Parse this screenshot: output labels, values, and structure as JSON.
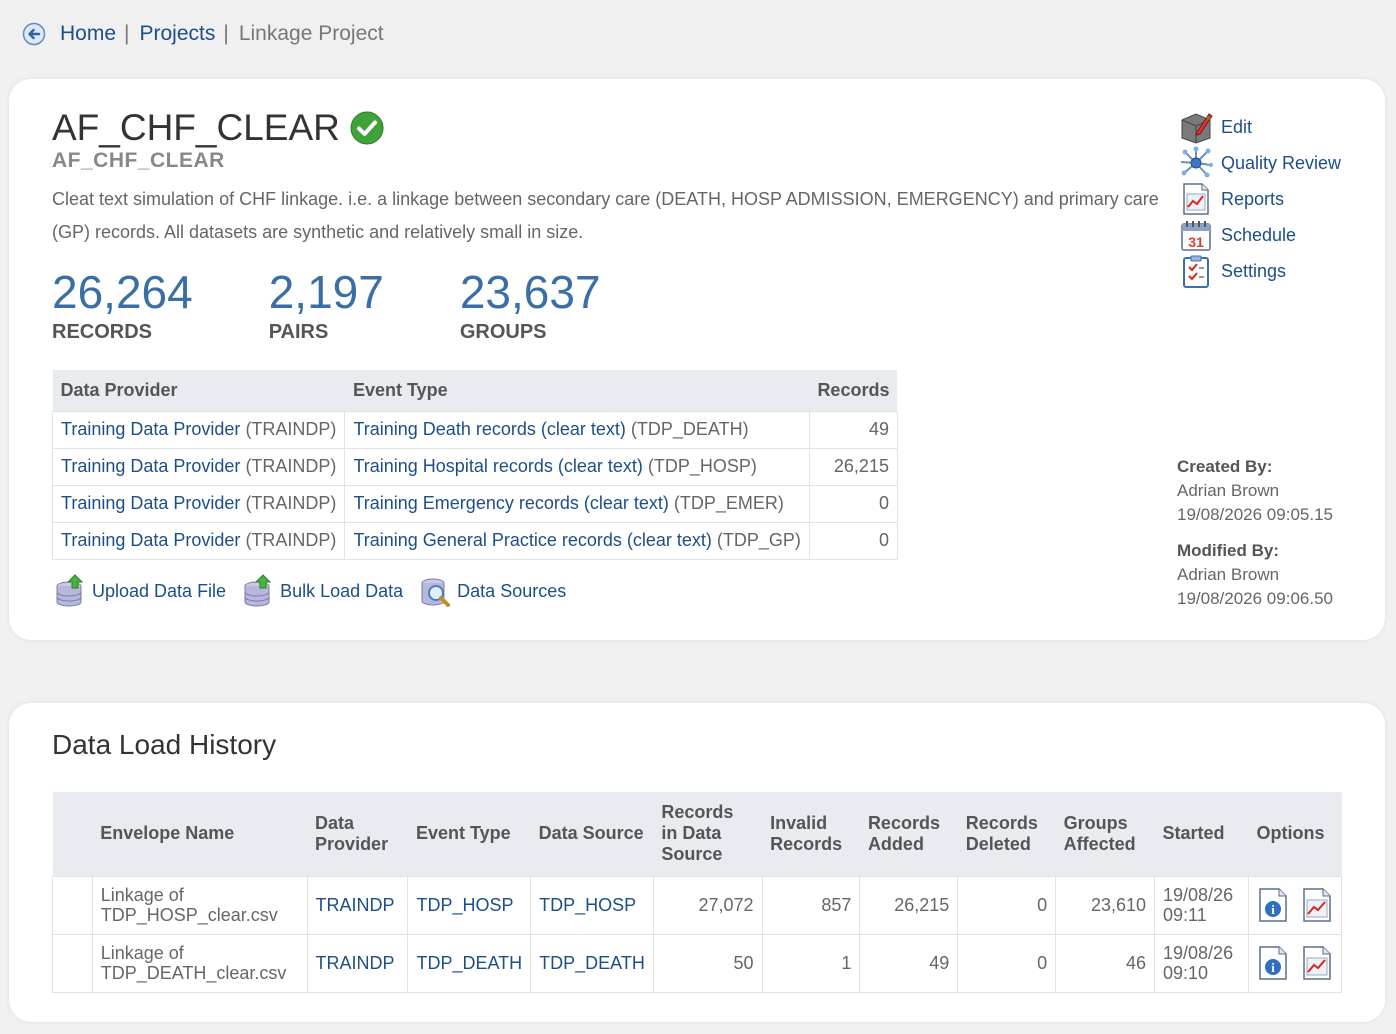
{
  "breadcrumb": {
    "home": "Home",
    "projects": "Projects",
    "current": "Linkage Project",
    "separator": "|"
  },
  "project": {
    "title": "AF_CHF_CLEAR",
    "code": "AF_CHF_CLEAR",
    "description": "Cleat text simulation of CHF linkage. i.e. a linkage between secondary care (DEATH, HOSP ADMISSION, EMERGENCY) and primary care (GP) records. All datasets are synthetic and relatively small in size.",
    "status_icon": "check-circle-icon"
  },
  "stats": [
    {
      "value": "26,264",
      "label": "RECORDS"
    },
    {
      "value": "2,197",
      "label": "PAIRS"
    },
    {
      "value": "23,637",
      "label": "GROUPS"
    }
  ],
  "providers": {
    "headers": [
      "Data Provider",
      "Event Type",
      "Records"
    ],
    "rows": [
      {
        "provider": "Training Data Provider",
        "provider_code": "(TRAINDP)",
        "event": "Training Death records (clear text)",
        "event_code": "(TDP_DEATH)",
        "records": "49"
      },
      {
        "provider": "Training Data Provider",
        "provider_code": "(TRAINDP)",
        "event": "Training Hospital records (clear text)",
        "event_code": "(TDP_HOSP)",
        "records": "26,215"
      },
      {
        "provider": "Training Data Provider",
        "provider_code": "(TRAINDP)",
        "event": "Training Emergency records (clear text)",
        "event_code": "(TDP_EMER)",
        "records": "0"
      },
      {
        "provider": "Training Data Provider",
        "provider_code": "(TRAINDP)",
        "event": "Training General Practice records (clear text)",
        "event_code": "(TDP_GP)",
        "records": "0"
      }
    ]
  },
  "actions": {
    "upload": "Upload Data File",
    "bulk": "Bulk Load Data",
    "sources": "Data Sources"
  },
  "menu": {
    "edit": "Edit",
    "quality": "Quality Review",
    "reports": "Reports",
    "schedule": "Schedule",
    "settings": "Settings"
  },
  "meta": {
    "created_label": "Created By:",
    "created_by": "Adrian Brown",
    "created_at": "19/08/2026 09:05.15",
    "modified_label": "Modified By:",
    "modified_by": "Adrian Brown",
    "modified_at": "19/08/2026 09:06.50"
  },
  "history": {
    "title": "Data Load History",
    "headers": {
      "envelope": "Envelope Name",
      "provider_1": "Data",
      "provider_2": "Provider",
      "event": "Event Type",
      "source": "Data Source",
      "recsrc_1": "Records",
      "recsrc_2": "in Data",
      "recsrc_3": "Source",
      "invalid_1": "Invalid",
      "invalid_2": "Records",
      "added_1": "Records",
      "added_2": "Added",
      "deleted_1": "Records",
      "deleted_2": "Deleted",
      "groups_1": "Groups",
      "groups_2": "Affected",
      "started": "Started",
      "options": "Options"
    },
    "rows": [
      {
        "envelope_1": "Linkage of",
        "envelope_2": "TDP_HOSP_clear.csv",
        "provider": "TRAINDP",
        "event": "TDP_HOSP",
        "source": "TDP_HOSP",
        "records_in_source": "27,072",
        "invalid": "857",
        "added": "26,215",
        "deleted": "0",
        "groups": "23,610",
        "started_1": "19/08/26",
        "started_2": "09:11"
      },
      {
        "envelope_1": "Linkage of",
        "envelope_2": "TDP_DEATH_clear.csv",
        "provider": "TRAINDP",
        "event": "TDP_DEATH",
        "source": "TDP_DEATH",
        "records_in_source": "50",
        "invalid": "1",
        "added": "49",
        "deleted": "0",
        "groups": "46",
        "started_1": "19/08/26",
        "started_2": "09:10"
      }
    ]
  },
  "colors": {
    "accent": "#3a6ea5",
    "link": "#1d4e89",
    "header_bg": "#e8ecf1"
  }
}
